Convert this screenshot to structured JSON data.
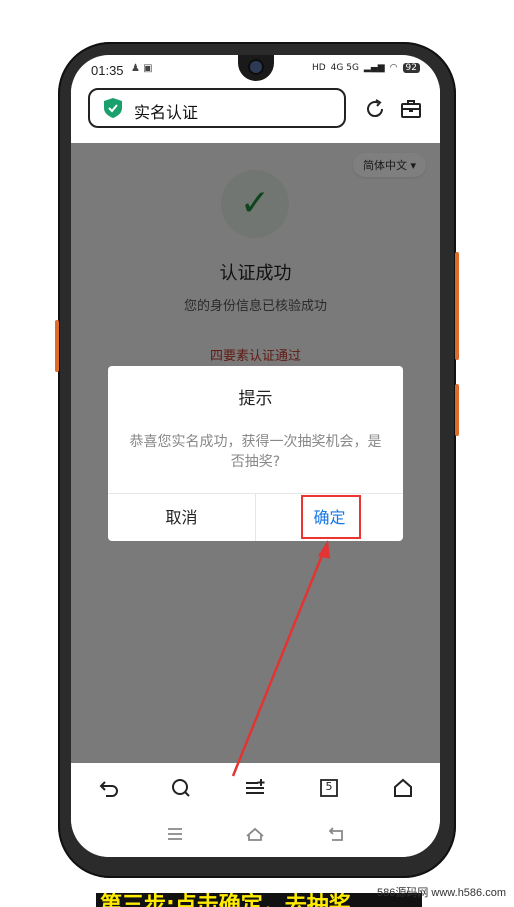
{
  "status": {
    "time": "01:35",
    "battery": "92",
    "net": "4G 5G"
  },
  "address": {
    "title": "实名认证"
  },
  "page": {
    "language": "简体中文",
    "success_title": "认证成功",
    "success_sub": "您的身份信息已核验成功",
    "success_red": "四要素认证通过"
  },
  "dialog": {
    "title": "提示",
    "message": "恭喜您实名成功，获得一次抽奖机会，是否抽奖?",
    "cancel": "取消",
    "ok": "确定"
  },
  "browser_bar": {
    "tabs_count": "5"
  },
  "caption": "第三步:点击确定，去抽奖",
  "watermark": "586源码网 www.h586.com",
  "colors": {
    "accent": "#1677e6",
    "highlight": "#e33333",
    "shield": "#1aa06d"
  }
}
